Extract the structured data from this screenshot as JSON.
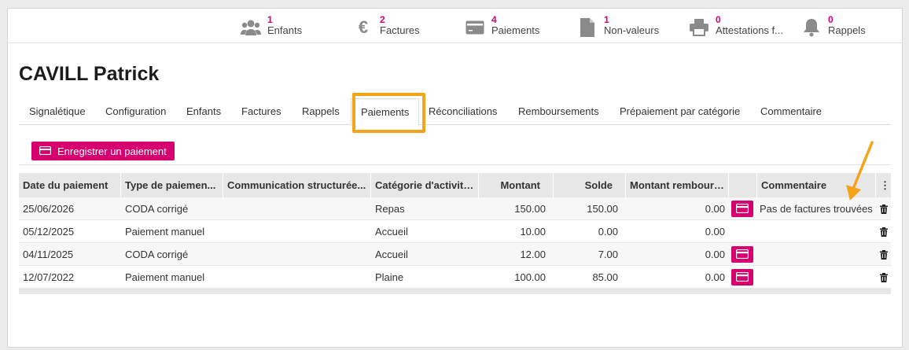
{
  "stats": [
    {
      "num": "1",
      "label": "Enfants",
      "icon": "users-icon"
    },
    {
      "num": "2",
      "label": "Factures",
      "icon": "euro-icon"
    },
    {
      "num": "4",
      "label": "Paiements",
      "icon": "credit-card-icon"
    },
    {
      "num": "1",
      "label": "Non-valeurs",
      "icon": "document-icon"
    },
    {
      "num": "0",
      "label": "Attestations f...",
      "icon": "printer-icon"
    },
    {
      "num": "0",
      "label": "Rappels",
      "icon": "bell-icon"
    }
  ],
  "page_title": "CAVILL Patrick",
  "tabs": [
    "Signalétique",
    "Configuration",
    "Enfants",
    "Factures",
    "Rappels",
    "Paiements",
    "Réconciliations",
    "Remboursements",
    "Prépaiement par catégorie",
    "Commentaire"
  ],
  "active_tab": "Paiements",
  "register_button": "Enregistrer un paiement",
  "table": {
    "headers": [
      "Date du paiement",
      "Type de paiemen...",
      "Communication structurée...",
      "Catégorie d'activité...",
      "Montant",
      "Solde",
      "Montant remboursé",
      "",
      "Commentaire"
    ],
    "rows": [
      {
        "date": "25/06/2026",
        "type": "CODA corrigé",
        "communication": "",
        "category": "Repas",
        "amount": "150.00",
        "balance": "150.00",
        "refunded": "0.00",
        "card": true,
        "comment": "Pas de factures trouvées"
      },
      {
        "date": "05/12/2025",
        "type": "Paiement manuel",
        "communication": "",
        "category": "Accueil",
        "amount": "10.00",
        "balance": "0.00",
        "refunded": "0.00",
        "card": false,
        "comment": ""
      },
      {
        "date": "04/11/2025",
        "type": "CODA corrigé",
        "communication": "",
        "category": "Accueil",
        "amount": "12.00",
        "balance": "7.00",
        "refunded": "0.00",
        "card": true,
        "comment": ""
      },
      {
        "date": "12/07/2022",
        "type": "Paiement manuel",
        "communication": "",
        "category": "Plaine",
        "amount": "100.00",
        "balance": "85.00",
        "refunded": "0.00",
        "card": true,
        "comment": ""
      }
    ]
  },
  "colors": {
    "accent": "#d6006f",
    "highlight": "#f5a31a",
    "header_bg": "#e7e7e7"
  }
}
